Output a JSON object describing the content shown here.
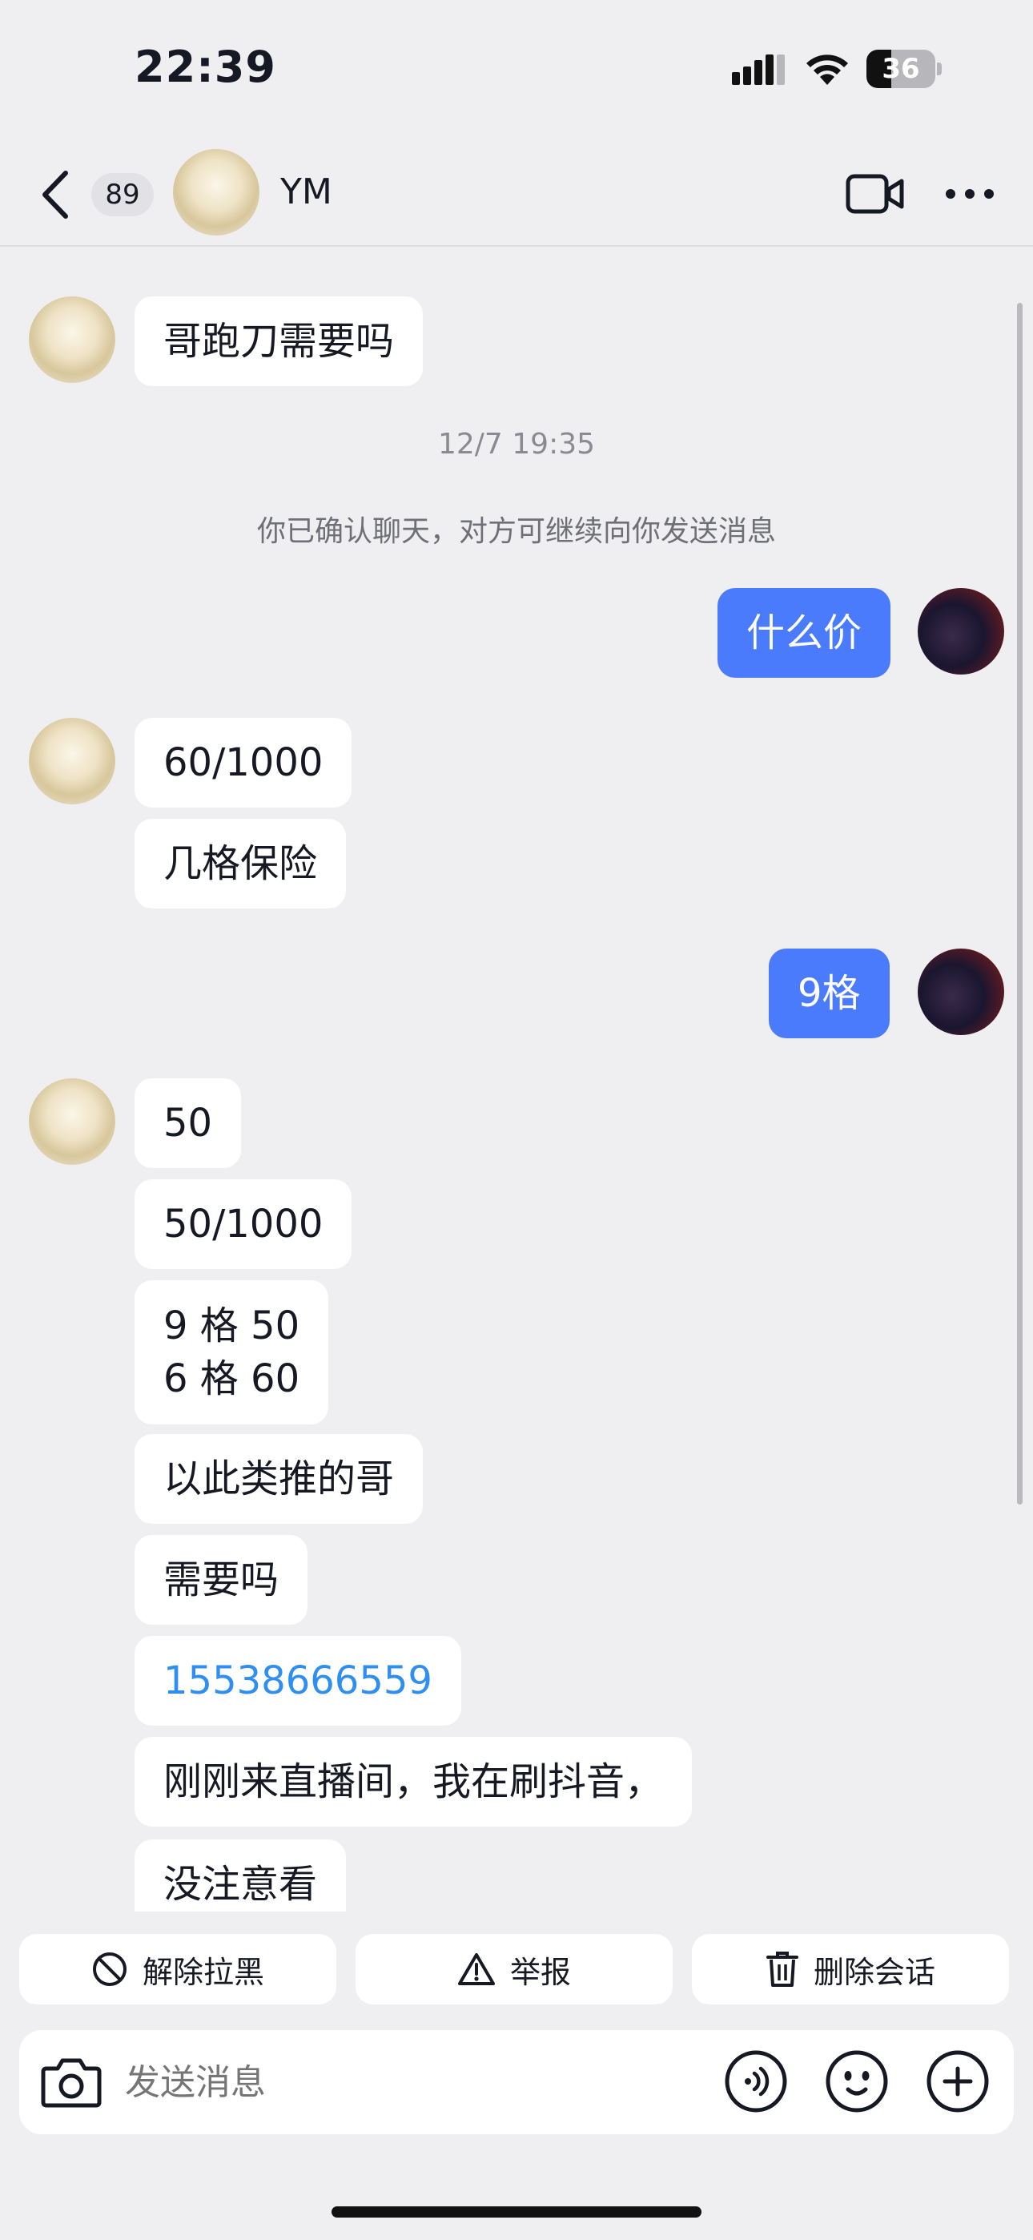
{
  "status_bar": {
    "time": "22:39",
    "battery_level": "36",
    "battery_fraction": 0.36,
    "icons": [
      "cellular-signal-icon",
      "wifi-icon",
      "battery-icon"
    ]
  },
  "header": {
    "unread_count": "89",
    "contact_name": "YM",
    "icons": [
      "back-arrow-icon",
      "video-call-icon",
      "more-icon"
    ]
  },
  "chat": {
    "timestamp": "12/7 19:35",
    "system_notice": "你已确认聊天，对方可继续向你发送消息",
    "messages_before": [
      "哥跑刀需要吗"
    ],
    "messages_me_1": [
      "什么价"
    ],
    "messages_other_1": [
      "60/1000",
      "几格保险"
    ],
    "messages_me_2": [
      "9格"
    ],
    "messages_other_2": [
      "50",
      "50/1000",
      "9 格 50\n6 格 60",
      "以此类推的哥",
      "需要吗",
      "15538666559",
      "刚刚来直播间，我在刷抖音，",
      "没注意看"
    ]
  },
  "actions": {
    "unblock_label": "解除拉黑",
    "report_label": "举报",
    "delete_label": "删除会话"
  },
  "input": {
    "placeholder": "发送消息",
    "icons": [
      "camera-icon",
      "voice-icon",
      "emoji-icon",
      "plus-icon"
    ]
  },
  "colors": {
    "background": "#efeff1",
    "my_bubble": "#4b7bfd",
    "other_bubble": "#ffffff",
    "link": "#2f8ff0"
  }
}
